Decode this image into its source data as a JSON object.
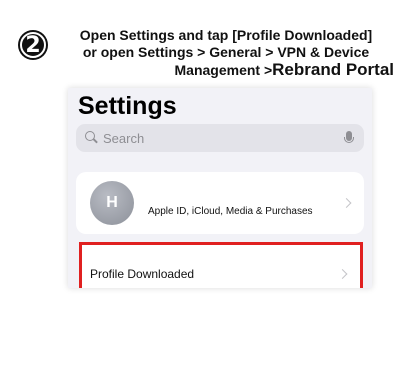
{
  "step": {
    "number": "2"
  },
  "caption": {
    "line1": "Open Settings and tap [Profile Downloaded]",
    "line2": "or open Settings > General > VPN & Device",
    "line3_prefix": "Management >",
    "line3_highlight": "Rebrand Portal"
  },
  "phone": {
    "title": "Settings",
    "search_placeholder": "Search",
    "apple_id_row": {
      "avatar_initials": "H",
      "label": "Apple ID, iCloud, Media & Purchases"
    },
    "profile_row": {
      "label": "Profile Downloaded"
    },
    "colors": {
      "highlight_border": "#e02020",
      "background": "#f2f2f7"
    }
  }
}
